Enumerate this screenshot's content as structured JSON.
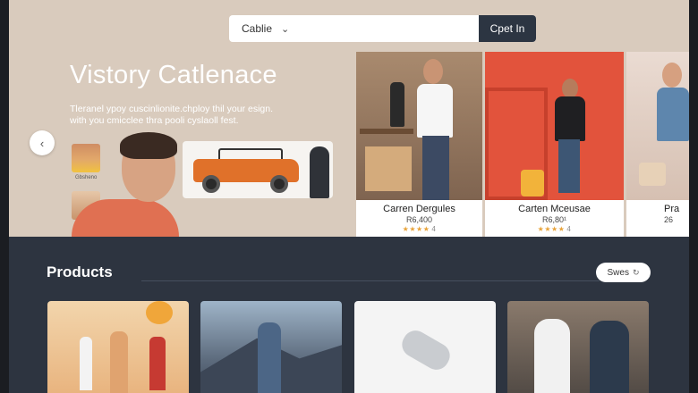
{
  "search": {
    "select_value": "Cablie",
    "input_placeholder": "",
    "button_label": "Cpet In"
  },
  "hero": {
    "title": "Vistory Catlenace",
    "subtitle": "Tleranel ypoy cuscinlionite.chploy thil your esign. with you cmicclee thra pooli cyslaoll fest.",
    "thumb_caption": "Gbsheno"
  },
  "featured_products": [
    {
      "name": "Carren Dergules",
      "price": "R6,400",
      "stars": "★★★★",
      "rating_count": "4"
    },
    {
      "name": "Carten Mceusae",
      "price": "R6,80¹",
      "stars": "★★★★",
      "rating_count": "4"
    },
    {
      "name": "Pra",
      "price": "26",
      "stars": "",
      "rating_count": ""
    }
  ],
  "products": {
    "title": "Products",
    "sort_label": "Swes"
  },
  "colors": {
    "hero_bg": "#d9cbbd",
    "page_bg": "#2d3440",
    "accent_button": "#2c3542",
    "star": "#e8a33a"
  },
  "icons": {
    "select": "chevron-down-icon",
    "carousel_prev": "chevron-left-icon",
    "sort": "sort-icon"
  }
}
